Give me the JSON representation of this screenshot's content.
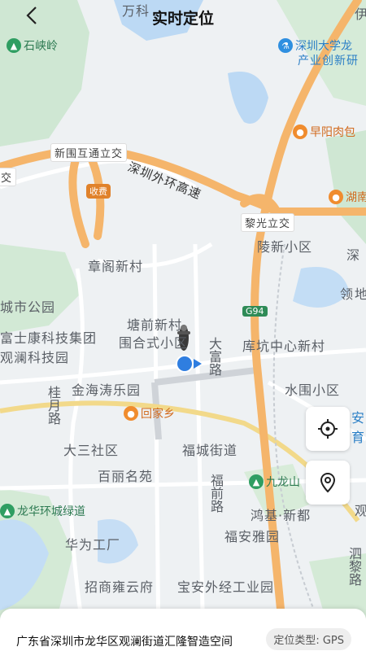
{
  "header": {
    "title": "实时定位",
    "back_icon": "chevron-left-icon"
  },
  "map": {
    "labels": {
      "wanke": "万科",
      "shixialing": "石峡岭",
      "szu_line1": "深圳大学龙",
      "szu_line2": "产业创新研",
      "zaoyang": "早阳肉包",
      "xinwei": "新围互通立交",
      "jiao_left": "交",
      "waihuan": "深圳外环高速",
      "shoufei": "收费",
      "hunan": "湖南",
      "liguang": "黎光立交",
      "zhangge": "章阁新村",
      "lingxin": "陵新小区",
      "shen": "深",
      "ling": "领",
      "lingdi": "地",
      "chengshi": "城市公园",
      "g94": "G94",
      "tangqian": "塘前新村",
      "weihe": "围合式小区",
      "dafu": "大富路",
      "fushikang": "富士康科技集团",
      "guanlan": "观澜科技园",
      "kukeng": "库坑中心新村",
      "jinhai": "金海涛乐园",
      "shuiwei": "水围小区",
      "guiyue": "桂月路",
      "huijiaxiang": "回家乡",
      "right_edge_1": "安",
      "right_edge_2": "育",
      "dasan": "大三社区",
      "fucheng": "福城街道",
      "baili": "百丽名苑",
      "jiulongshan": "九龙山",
      "fuqian": "福前路",
      "longhua": "龙华环城绿道",
      "hongji": "鸿基·新都",
      "guan": "观",
      "fuanya": "福安雅园",
      "huawei": "华为工厂",
      "silin": "泗黎路",
      "zhaoshang": "招商雍云府",
      "baoan": "宝安外经工业园",
      "yiyi": "伊"
    }
  },
  "controls": {
    "locate_icon": "crosshair-icon",
    "pin_icon": "location-pin-icon"
  },
  "panel": {
    "address": "广东省深圳市龙华区观澜街道汇隆智造空间",
    "location_type": "定位类型: GPS"
  },
  "colors": {
    "highway": "#f4b46a",
    "road": "#ffffff",
    "green": "#cde8d2",
    "water": "#b9d7f3",
    "marker": "#2f7ee0"
  }
}
